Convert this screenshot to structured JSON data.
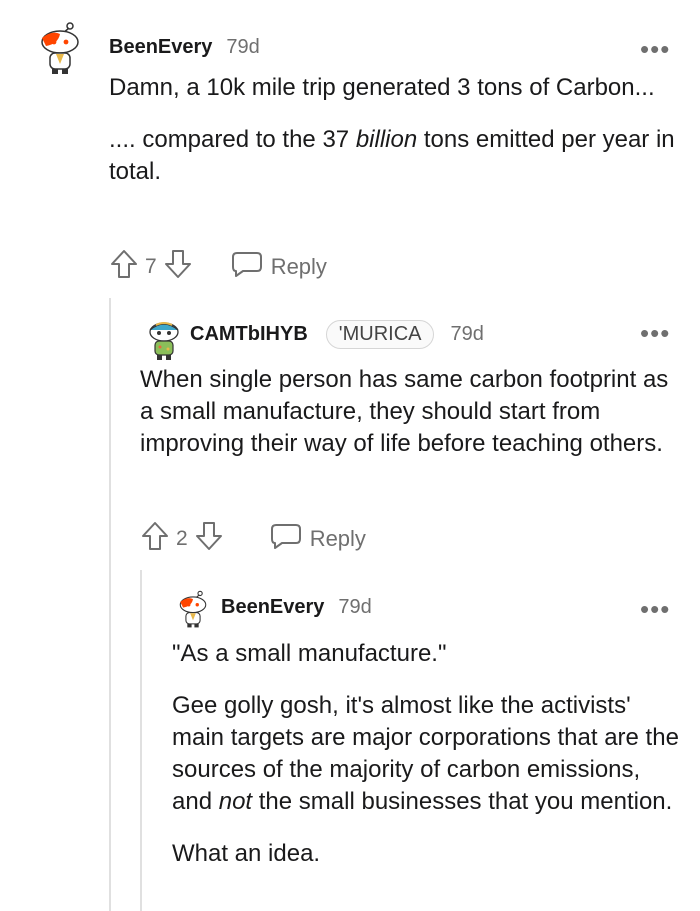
{
  "comments": [
    {
      "username": "BeenEvery",
      "time": "79d",
      "paragraphs": [
        {
          "a": "Damn, a 10k mile trip generated 3 tons of Carbon..."
        },
        {
          "a": ".... compared to the 37 ",
          "em": "billion",
          "b": " tons emitted per year in total."
        }
      ],
      "score": "7",
      "reply_label": "Reply",
      "more_label": "•••"
    },
    {
      "username": "CAMTbIHYB",
      "flair": "'MURICA",
      "time": "79d",
      "paragraphs": [
        {
          "a": "When single person has same carbon footprint as a small manufacture, they should start from improving their way of life before teaching others."
        }
      ],
      "score": "2",
      "reply_label": "Reply",
      "more_label": "•••"
    },
    {
      "username": "BeenEvery",
      "time": "79d",
      "paragraphs": [
        {
          "a": "\"As a small manufacture.\""
        },
        {
          "a": "Gee golly gosh, it's almost like the activists' main targets are major corporations that are the sources of the majority of carbon emissions, and ",
          "em": "not",
          "b": " the small businesses that you mention."
        },
        {
          "a": "What an idea."
        }
      ],
      "more_label": "•••"
    }
  ],
  "icons": {
    "upvote": "upvote-arrow-icon",
    "downvote": "downvote-arrow-icon",
    "reply": "speech-bubble-icon",
    "more": "ellipsis-icon",
    "avatar": "snoo-avatar-icon"
  },
  "colors": {
    "text": "#1a1a1b",
    "meta": "#6f6f6f",
    "thread": "#e0e0e0",
    "snoo_orange": "#ff4500"
  }
}
